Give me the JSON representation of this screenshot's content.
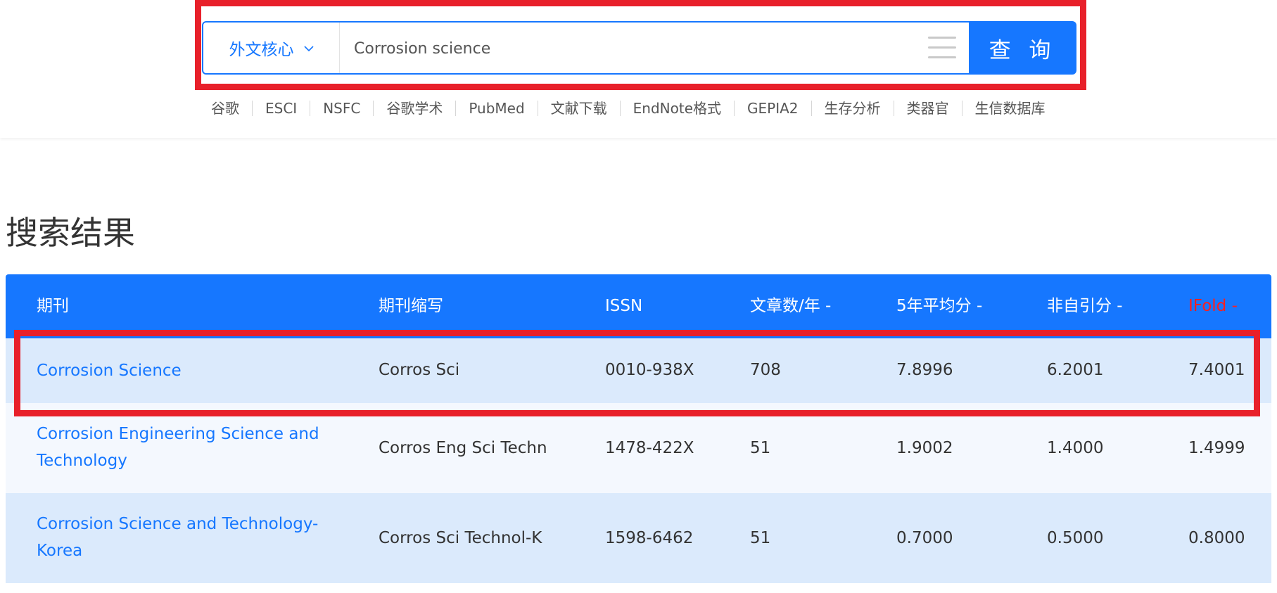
{
  "search": {
    "scope_label": "外文核心",
    "query_value": "Corrosion science",
    "button_label": "查 询"
  },
  "quick_links": [
    "谷歌",
    "ESCI",
    "NSFC",
    "谷歌学术",
    "PubMed",
    "文献下载",
    "EndNote格式",
    "GEPIA2",
    "生存分析",
    "类器官",
    "生信数据库"
  ],
  "results": {
    "title": "搜索结果",
    "columns": [
      "期刊",
      "期刊缩写",
      "ISSN",
      "文章数/年 -",
      "5年平均分 -",
      "非自引分 -",
      "IFold -"
    ],
    "rows": [
      {
        "journal": "Corrosion Science",
        "abbr": "Corros Sci",
        "issn": "0010-938X",
        "articles": "708",
        "avg5": "7.8996",
        "nonself": "6.2001",
        "ifold": "7.4001"
      },
      {
        "journal": "Corrosion Engineering Science and Technology",
        "abbr": "Corros Eng Sci Techn",
        "issn": "1478-422X",
        "articles": "51",
        "avg5": "1.9002",
        "nonself": "1.4000",
        "ifold": "1.4999"
      },
      {
        "journal": "Corrosion Science and Technology-Korea",
        "abbr": "Corros Sci Technol-K",
        "issn": "1598-6462",
        "articles": "51",
        "avg5": "0.7000",
        "nonself": "0.5000",
        "ifold": "0.8000"
      }
    ]
  },
  "colors": {
    "accent": "#1677ff",
    "highlight": "#e8202a",
    "sort_active": "#ff1f1f"
  }
}
